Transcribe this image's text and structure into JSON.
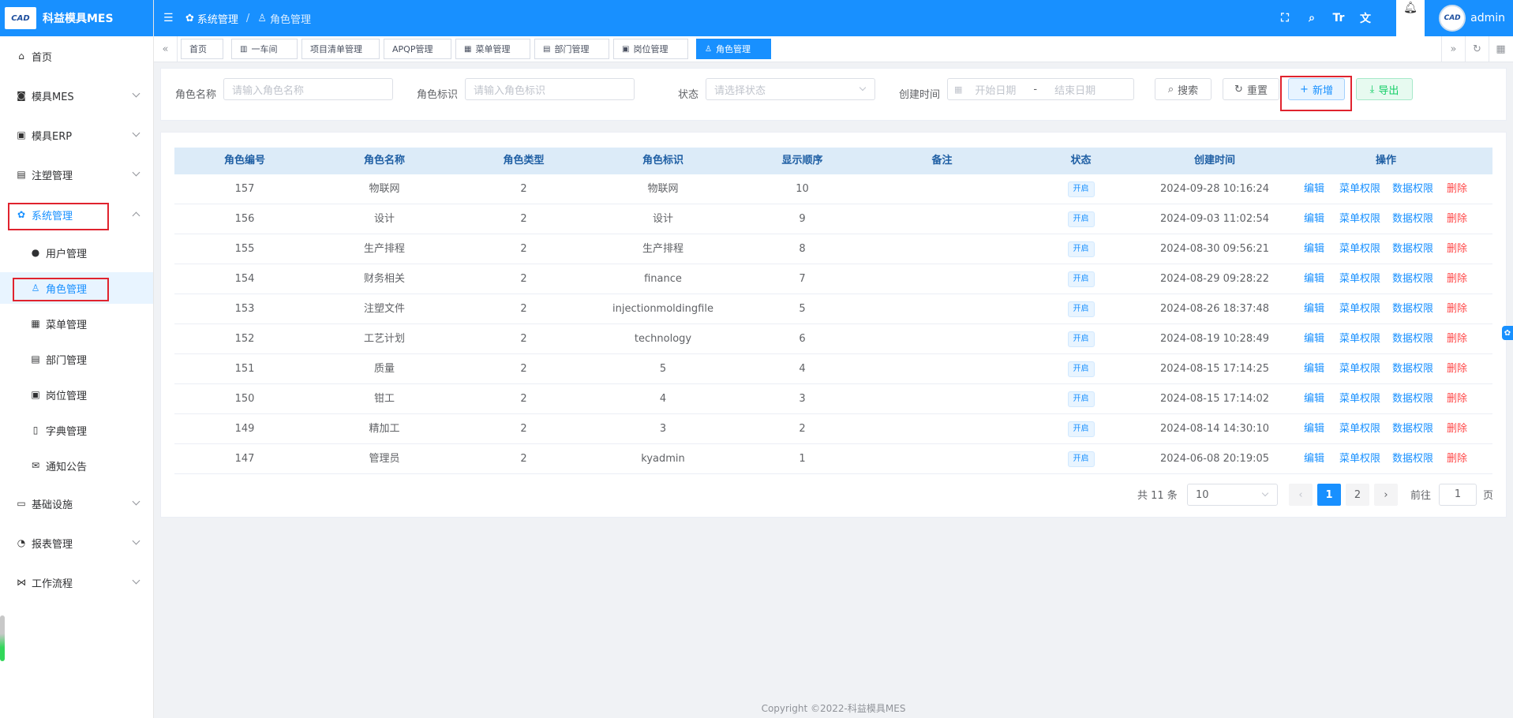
{
  "app": {
    "title": "科益模具MES",
    "logo_text": "CAD"
  },
  "sidebar": {
    "items": [
      {
        "label": "首页",
        "icon": "home-icon",
        "glyph": "⌂"
      },
      {
        "label": "模具MES",
        "icon": "camera-icon",
        "glyph": "◙"
      },
      {
        "label": "模具ERP",
        "icon": "bag-icon",
        "glyph": "▣"
      },
      {
        "label": "注塑管理",
        "icon": "briefcase-icon",
        "glyph": "▤"
      },
      {
        "label": "系统管理",
        "icon": "gear-icon",
        "glyph": "✿"
      },
      {
        "label": "基础设施",
        "icon": "monitor-icon",
        "glyph": "▭"
      },
      {
        "label": "报表管理",
        "icon": "pie-chart-icon",
        "glyph": "◔"
      },
      {
        "label": "工作流程",
        "icon": "flow-icon",
        "glyph": "⋈"
      }
    ],
    "sub_items": [
      {
        "label": "用户管理",
        "icon": "user-icon",
        "glyph": "●"
      },
      {
        "label": "角色管理",
        "icon": "peoples-icon",
        "glyph": "♙"
      },
      {
        "label": "菜单管理",
        "icon": "grid-icon",
        "glyph": "▦"
      },
      {
        "label": "部门管理",
        "icon": "id-card-icon",
        "glyph": "▤"
      },
      {
        "label": "岗位管理",
        "icon": "post-icon",
        "glyph": "▣"
      },
      {
        "label": "字典管理",
        "icon": "book-icon",
        "glyph": "▯"
      },
      {
        "label": "通知公告",
        "icon": "message-icon",
        "glyph": "✉"
      }
    ]
  },
  "topbar": {
    "breadcrumb_parent": "系统管理",
    "breadcrumb_current": "角色管理",
    "user_name": "admin",
    "icons": [
      "fullscreen-icon",
      "search-icon",
      "font-size-icon",
      "translate-icon",
      "bell-icon"
    ]
  },
  "tags": [
    {
      "label": "首页",
      "glyph": ""
    },
    {
      "label": "一车间",
      "glyph": "▥"
    },
    {
      "label": "项目清单管理",
      "glyph": ""
    },
    {
      "label": "APQP管理",
      "glyph": ""
    },
    {
      "label": "菜单管理",
      "glyph": "▦"
    },
    {
      "label": "部门管理",
      "glyph": "▤"
    },
    {
      "label": "岗位管理",
      "glyph": "▣"
    },
    {
      "label": "角色管理",
      "glyph": "♙"
    }
  ],
  "search": {
    "role_name_label": "角色名称",
    "role_name_placeholder": "请输入角色名称",
    "role_key_label": "角色标识",
    "role_key_placeholder": "请输入角色标识",
    "status_label": "状态",
    "status_placeholder": "请选择状态",
    "time_label": "创建时间",
    "start_placeholder": "开始日期",
    "range_sep": "-",
    "end_placeholder": "结束日期",
    "search_btn": "搜索",
    "reset_btn": "重置",
    "add_btn": "新增",
    "export_btn": "导出"
  },
  "table": {
    "headers": [
      "角色编号",
      "角色名称",
      "角色类型",
      "角色标识",
      "显示顺序",
      "备注",
      "状态",
      "创建时间",
      "操作"
    ],
    "rows": [
      {
        "id": "157",
        "name": "物联网",
        "type": "2",
        "key": "物联网",
        "order": "10",
        "remark": "",
        "status": "开启",
        "time": "2024-09-28 10:16:24"
      },
      {
        "id": "156",
        "name": "设计",
        "type": "2",
        "key": "设计",
        "order": "9",
        "remark": "",
        "status": "开启",
        "time": "2024-09-03 11:02:54"
      },
      {
        "id": "155",
        "name": "生产排程",
        "type": "2",
        "key": "生产排程",
        "order": "8",
        "remark": "",
        "status": "开启",
        "time": "2024-08-30 09:56:21"
      },
      {
        "id": "154",
        "name": "财务相关",
        "type": "2",
        "key": "finance",
        "order": "7",
        "remark": "",
        "status": "开启",
        "time": "2024-08-29 09:28:22"
      },
      {
        "id": "153",
        "name": "注塑文件",
        "type": "2",
        "key": "injectionmoldingfile",
        "order": "5",
        "remark": "",
        "status": "开启",
        "time": "2024-08-26 18:37:48"
      },
      {
        "id": "152",
        "name": "工艺计划",
        "type": "2",
        "key": "technology",
        "order": "6",
        "remark": "",
        "status": "开启",
        "time": "2024-08-19 10:28:49"
      },
      {
        "id": "151",
        "name": "质量",
        "type": "2",
        "key": "5",
        "order": "4",
        "remark": "",
        "status": "开启",
        "time": "2024-08-15 17:14:25"
      },
      {
        "id": "150",
        "name": "钳工",
        "type": "2",
        "key": "4",
        "order": "3",
        "remark": "",
        "status": "开启",
        "time": "2024-08-15 17:14:02"
      },
      {
        "id": "149",
        "name": "精加工",
        "type": "2",
        "key": "3",
        "order": "2",
        "remark": "",
        "status": "开启",
        "time": "2024-08-14 14:30:10"
      },
      {
        "id": "147",
        "name": "管理员",
        "type": "2",
        "key": "kyadmin",
        "order": "1",
        "remark": "",
        "status": "开启",
        "time": "2024-06-08 20:19:05"
      }
    ],
    "actions": {
      "edit": "编辑",
      "menu_perm": "菜单权限",
      "data_perm": "数据权限",
      "delete": "删除"
    }
  },
  "pagination": {
    "total_text": "共 11 条",
    "page_size": "10",
    "pages": [
      "1",
      "2"
    ],
    "current_page": "1",
    "goto_label": "前往",
    "goto_value": "1",
    "page_suffix": "页"
  },
  "footer": {
    "copyright": "Copyright ©2022-科益模具MES"
  },
  "colors": {
    "primary": "#1890ff",
    "danger": "#ff4949",
    "success": "#13ce66",
    "header_bg": "#dcebf8"
  }
}
